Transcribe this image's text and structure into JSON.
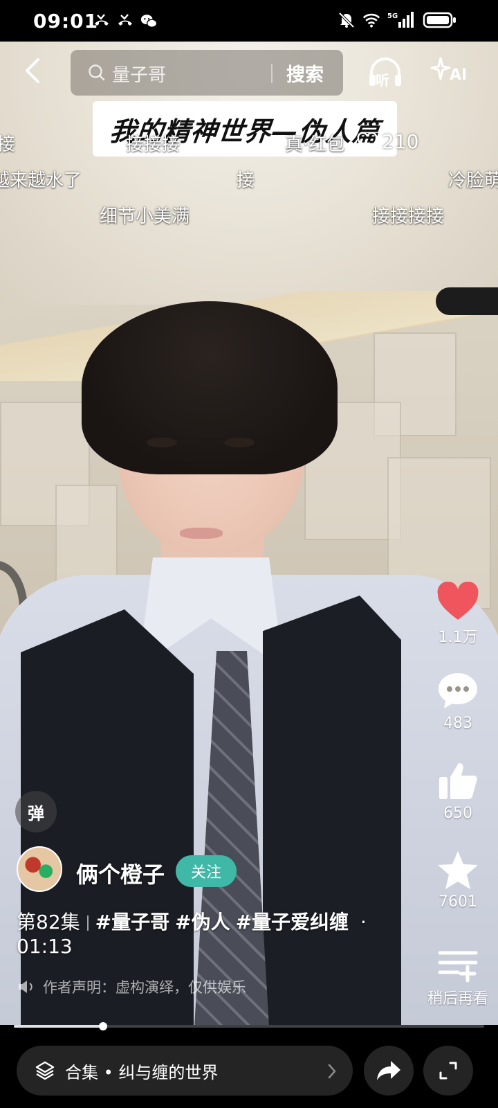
{
  "status_bar": {
    "time": "09:01",
    "network": "5G"
  },
  "top_bar": {
    "search_text": "量子哥",
    "search_button": "搜索",
    "listen_label": "听",
    "ai_label": "AI"
  },
  "video": {
    "title": "我的精神世界—伪人篇"
  },
  "danmaku": [
    {
      "text": "接"
    },
    {
      "text": "接接接"
    },
    {
      "text": "真·红包"
    },
    {
      "text": "越来越水了"
    },
    {
      "text": "接"
    },
    {
      "text": "冷脸萌"
    },
    {
      "text": "细节小美满"
    },
    {
      "text": "接接接接"
    }
  ],
  "danmaku_like_count": "210",
  "actions": {
    "like_count": "1.1万",
    "comment_count": "483",
    "thumb_count": "650",
    "favorite_count": "7601",
    "watch_later_label": "稍后再看"
  },
  "danmaku_toggle": "弹",
  "author": {
    "name": "俩个橙子",
    "follow_label": "关注"
  },
  "description": {
    "episode": "第82集",
    "tags": [
      "#量子哥",
      "#伪人",
      "#量子爱纠缠"
    ],
    "dot": "·",
    "duration": "01:13"
  },
  "disclaimer": "作者声明：虚构演绎，仅供娱乐",
  "progress": {
    "fraction": 0.19
  },
  "bottom_bar": {
    "collection_label": "合集 • 纠与缠的世界"
  },
  "colors": {
    "like_red": "#f0545d",
    "follow_teal": "#3fb8a7"
  }
}
